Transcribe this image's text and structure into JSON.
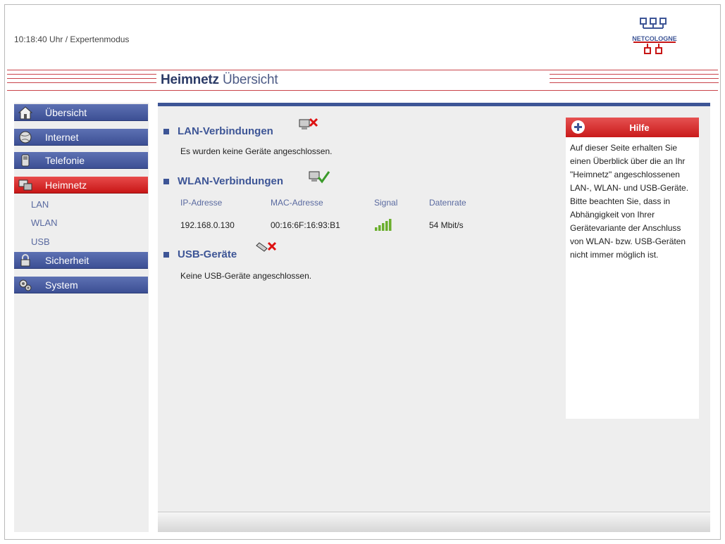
{
  "header": {
    "status": "10:18:40 Uhr  / Expertenmodus",
    "logo_text": "NETCOLOGNE"
  },
  "title": {
    "bold": "Heimnetz",
    "rest": "Übersicht"
  },
  "sidebar": {
    "items": [
      {
        "label": "Übersicht",
        "icon": "home-icon"
      },
      {
        "label": "Internet",
        "icon": "globe-icon"
      },
      {
        "label": "Telefonie",
        "icon": "phone-icon"
      },
      {
        "label": "Heimnetz",
        "icon": "network-icon",
        "active": true
      },
      {
        "label": "Sicherheit",
        "icon": "lock-icon"
      },
      {
        "label": "System",
        "icon": "gears-icon"
      }
    ],
    "subitems": [
      "LAN",
      "WLAN",
      "USB"
    ]
  },
  "main": {
    "lan": {
      "title": "LAN-Verbindungen",
      "icon": "network-error-icon",
      "text": "Es wurden keine Geräte angeschlossen."
    },
    "wlan": {
      "title": "WLAN-Verbindungen",
      "icon": "network-ok-icon",
      "columns": [
        "IP-Adresse",
        "MAC-Adresse",
        "Signal",
        "Datenrate"
      ],
      "rows": [
        {
          "ip": "192.168.0.130",
          "mac": "00:16:6F:16:93:B1",
          "signal_bars": 5,
          "rate": "54 Mbit/s"
        }
      ]
    },
    "usb": {
      "title": "USB-Geräte",
      "icon": "usb-error-icon",
      "text": "Keine USB-Geräte angeschlossen."
    }
  },
  "help": {
    "title": "Hilfe",
    "text": "Auf dieser Seite erhalten Sie einen Überblick über die an Ihr \"Heimnetz\" angeschlossenen LAN-, WLAN- und USB-Geräte. Bitte beachten Sie, dass in Abhängigkeit von Ihrer Gerätevariante der Anschluss von WLAN- bzw. USB-Geräten nicht immer möglich ist."
  },
  "colors": {
    "nav": "#3c4f94",
    "active": "#c81616",
    "accent_line": "#c9434a"
  }
}
